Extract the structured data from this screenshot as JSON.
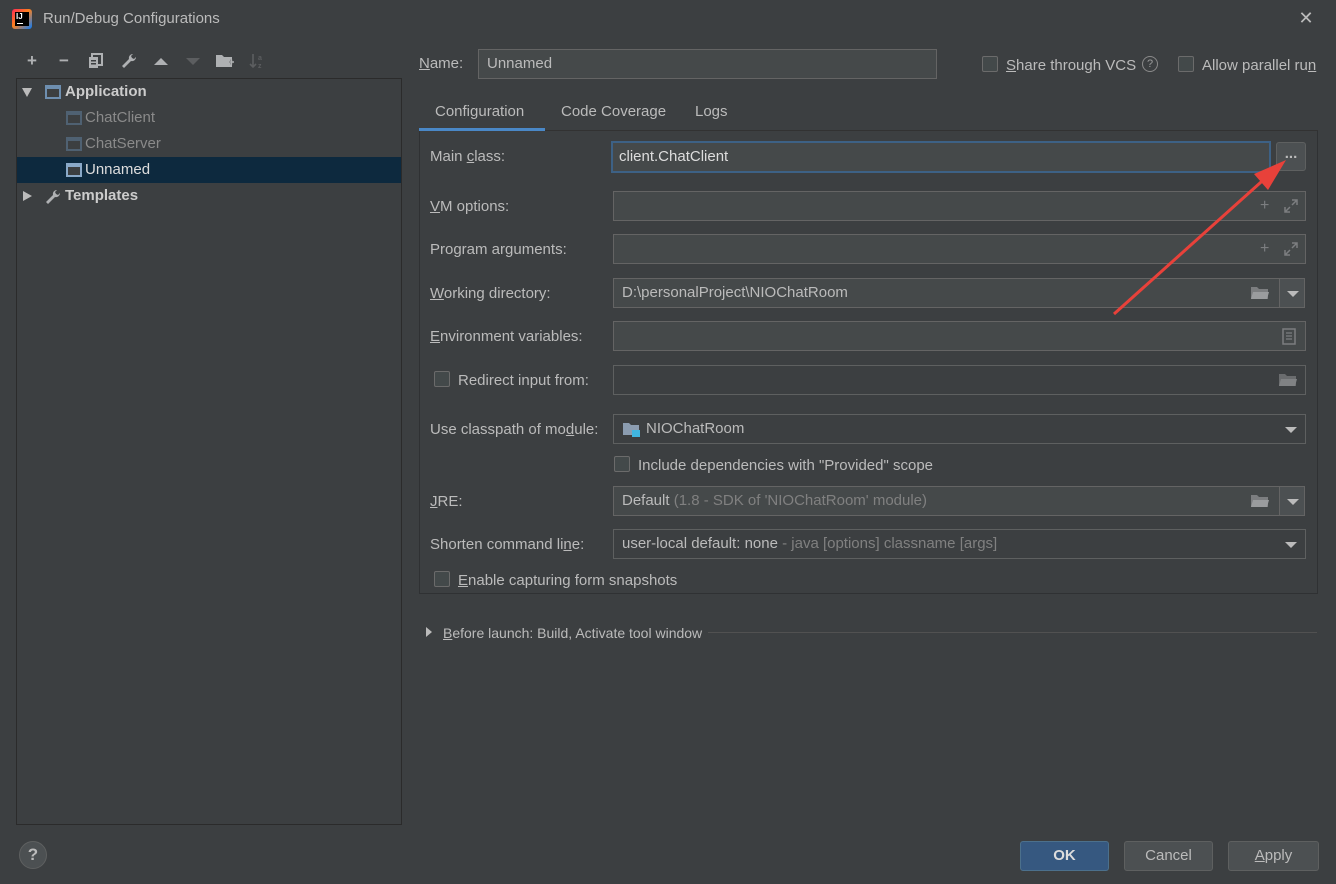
{
  "window": {
    "title": "Run/Debug Configurations",
    "app_icon_text": "IJ"
  },
  "toolbar": {
    "icons": [
      "add-icon",
      "remove-icon",
      "copy-icon",
      "wrench-icon",
      "move-up-icon",
      "move-down-icon",
      "new-folder-icon",
      "sort-icon"
    ]
  },
  "tree": {
    "application": "Application",
    "items": [
      "ChatClient",
      "ChatServer",
      "Unnamed"
    ],
    "templates": "Templates"
  },
  "header": {
    "name_label_prefix": "N",
    "name_label_rest": "ame:",
    "name_value": "Unnamed",
    "share_vcs_prefix": "S",
    "share_vcs_rest": "hare through VCS",
    "help_glyph": "?",
    "allow_parallel_prefix": "Allow parallel ru",
    "allow_parallel_u": "n"
  },
  "tabs": [
    "Configuration",
    "Code Coverage",
    "Logs"
  ],
  "form": {
    "main_class_label_a": "Main ",
    "main_class_label_u": "c",
    "main_class_label_b": "lass:",
    "main_class_value": "client.ChatClient",
    "browse_label": "...",
    "vm_options_u": "V",
    "vm_options_rest": "M options:",
    "program_args_a": "Program ar",
    "program_args_u": "g",
    "program_args_b": "uments:",
    "working_dir_u": "W",
    "working_dir_rest": "orking directory:",
    "working_dir_value": "D:\\personalProject\\NIOChatRoom",
    "env_vars_u": "E",
    "env_vars_rest": "nvironment variables:",
    "redirect_label": "Redirect input from:",
    "classpath_a": "Use classpath of mo",
    "classpath_u": "d",
    "classpath_b": "ule:",
    "module_value": "NIOChatRoom",
    "include_deps_label": "Include dependencies with \"Provided\" scope",
    "jre_u": "J",
    "jre_rest": "RE:",
    "jre_value": "Default",
    "jre_hint": " (1.8 - SDK of 'NIOChatRoom' module)",
    "shorten_a": "Shorten command li",
    "shorten_u": "n",
    "shorten_b": "e:",
    "shorten_value": "user-local default: none",
    "shorten_hint": " - java [options] classname [args]",
    "snapshots_u": "E",
    "snapshots_rest": "nable capturing form snapshots"
  },
  "before_launch": {
    "u": "B",
    "rest": "efore launch: Build, Activate tool window"
  },
  "buttons": {
    "ok": "OK",
    "cancel": "Cancel",
    "apply_u": "A",
    "apply_rest": "pply",
    "help": "?"
  },
  "colors": {
    "background": "#3c3f41",
    "selection": "#0d293e",
    "accent": "#4a88c7",
    "primary_button": "#365880",
    "annotation_arrow": "#e8413a"
  }
}
